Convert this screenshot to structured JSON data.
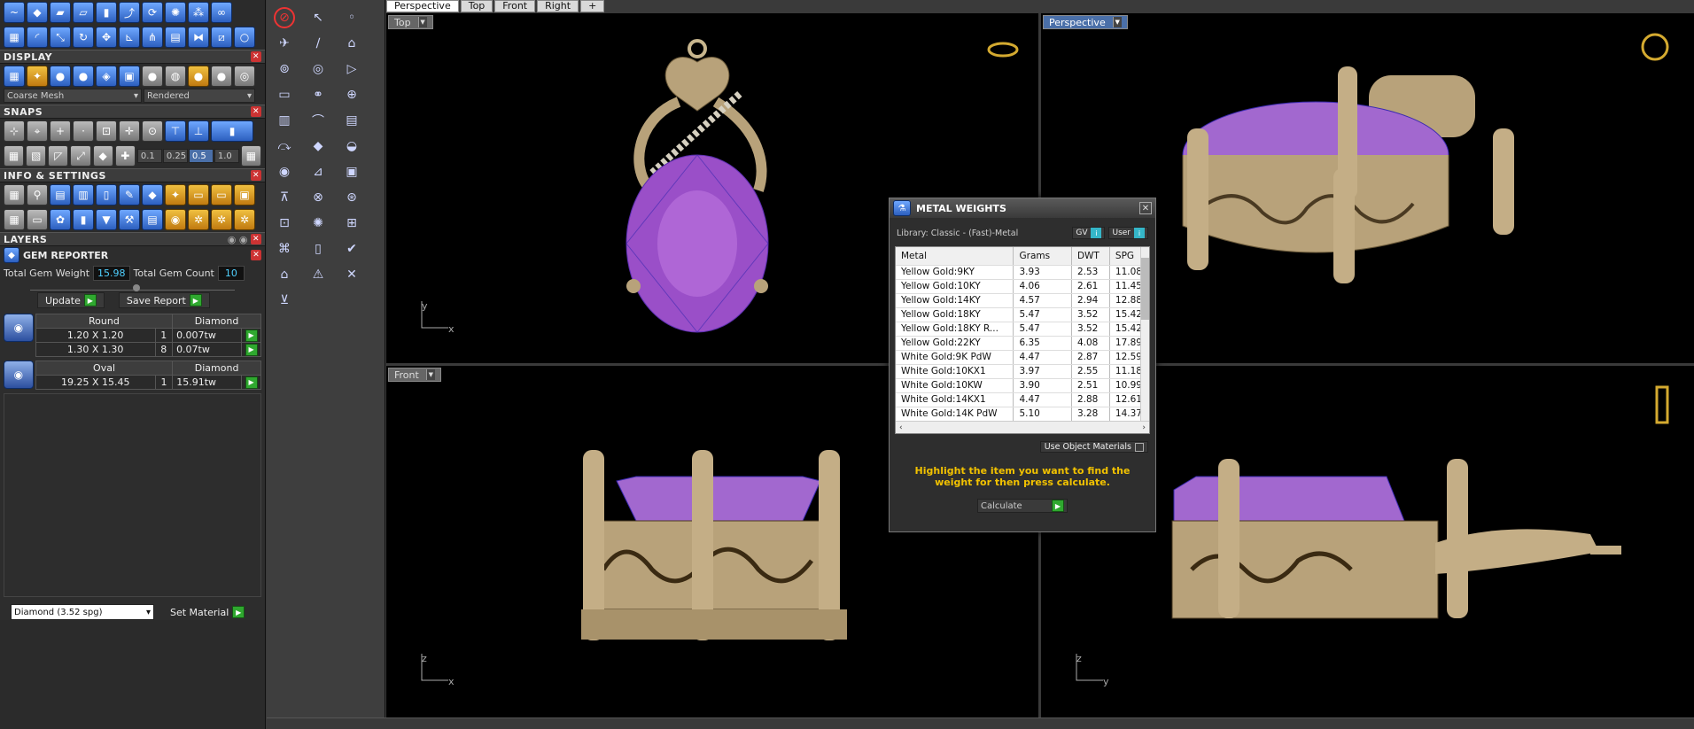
{
  "tabs": [
    "Perspective",
    "Top",
    "Front",
    "Right",
    "+"
  ],
  "sections": {
    "display": "DISPLAY",
    "snaps": "SNAPS",
    "info": "INFO & SETTINGS",
    "layers": "LAYERS"
  },
  "display": {
    "mesh": "Coarse Mesh",
    "mode": "Rendered"
  },
  "snaps": {
    "values": [
      "0.1",
      "0.25",
      "0.5",
      "1.0"
    ]
  },
  "gem": {
    "title": "GEM REPORTER",
    "total_weight_label": "Total Gem Weight",
    "total_weight": "15.98",
    "total_count_label": "Total Gem Count",
    "total_count": "10",
    "update": "Update",
    "save": "Save Report",
    "groups": [
      {
        "shape": "Round",
        "material": "Diamond",
        "rows": [
          [
            "1.20 X 1.20",
            "1",
            "0.007tw"
          ],
          [
            "1.30 X 1.30",
            "8",
            "0.07tw"
          ]
        ]
      },
      {
        "shape": "Oval",
        "material": "Diamond",
        "rows": [
          [
            "19.25 X 15.45",
            "1",
            "15.91tw"
          ]
        ]
      }
    ],
    "material_select": "Diamond    (3.52 spg)",
    "set_material": "Set Material"
  },
  "viewports": {
    "top": "Top",
    "perspective": "Perspective",
    "front": "Front"
  },
  "dialog": {
    "title": "METAL WEIGHTS",
    "library": "Library: Classic - (Fast)-Metal",
    "gv": "GV",
    "user": "User",
    "headers": [
      "Metal",
      "Grams",
      "DWT",
      "SPG"
    ],
    "rows": [
      [
        "Yellow Gold:9KY",
        "3.93",
        "2.53",
        "11.08"
      ],
      [
        "Yellow Gold:10KY",
        "4.06",
        "2.61",
        "11.45"
      ],
      [
        "Yellow Gold:14KY",
        "4.57",
        "2.94",
        "12.88"
      ],
      [
        "Yellow Gold:18KY",
        "5.47",
        "3.52",
        "15.42"
      ],
      [
        "Yellow Gold:18KY R...",
        "5.47",
        "3.52",
        "15.42"
      ],
      [
        "Yellow Gold:22KY",
        "6.35",
        "4.08",
        "17.89"
      ],
      [
        "White Gold:9K PdW",
        "4.47",
        "2.87",
        "12.59"
      ],
      [
        "White Gold:10KX1",
        "3.97",
        "2.55",
        "11.18"
      ],
      [
        "White Gold:10KW",
        "3.90",
        "2.51",
        "10.99"
      ],
      [
        "White Gold:14KX1",
        "4.47",
        "2.88",
        "12.61"
      ],
      [
        "White Gold:14K PdW",
        "5.10",
        "3.28",
        "14.37"
      ]
    ],
    "use_obj": "Use Object Materials",
    "message": "Highlight the item you want to find the weight for then press calculate.",
    "calculate": "Calculate"
  },
  "axis": {
    "y": "y",
    "x": "x",
    "z": "z"
  }
}
